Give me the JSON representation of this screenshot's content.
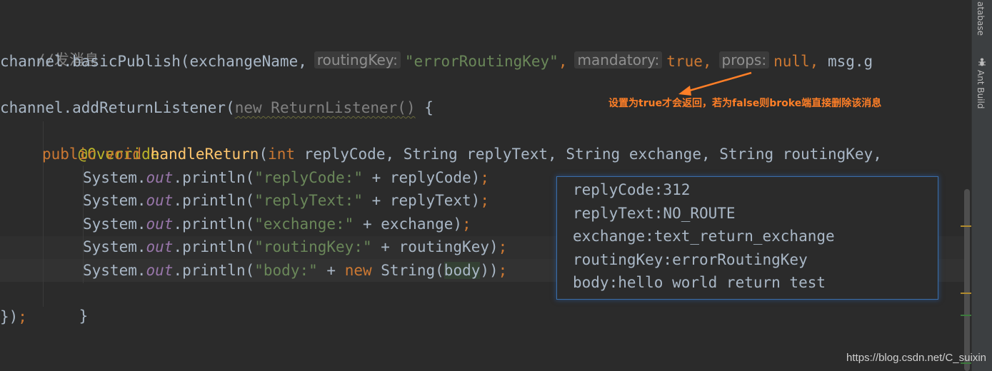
{
  "comment": "//发消息",
  "publish_line": {
    "prefix": "channel.basicPublish(exchangeName,",
    "hint_routing_key": "routingKey:",
    "routing_key_value": "\"errorRoutingKey\"",
    "comma1": ",",
    "hint_mandatory": "mandatory:",
    "mandatory_value": "true",
    "comma2": ",",
    "hint_props": "props:",
    "props_value": "null",
    "comma3": ",",
    "suffix": " msg.g"
  },
  "listener_line": {
    "prefix": "channel.addReturnListener(",
    "anon_class": "new ReturnListener()",
    "suffix": " {"
  },
  "override_annotation": "@Override",
  "method_signature": {
    "modifiers": "public void ",
    "name": "handleReturn",
    "open": "(",
    "type_int": "int",
    "params": " replyCode, String replyText, String exchange, String routingKey,"
  },
  "println_lines": [
    {
      "receiver": "System.",
      "field": "out",
      "call": ".println(",
      "literal": "\"replyCode:\"",
      "rest": " + replyCode)",
      "semi": ";"
    },
    {
      "receiver": "System.",
      "field": "out",
      "call": ".println(",
      "literal": "\"replyText:\"",
      "rest": " + replyText)",
      "semi": ";"
    },
    {
      "receiver": "System.",
      "field": "out",
      "call": ".println(",
      "literal": "\"exchange:\"",
      "rest": " + exchange)",
      "semi": ";"
    },
    {
      "receiver": "System.",
      "field": "out",
      "call": ".println(",
      "literal": "\"routingKey:\"",
      "rest": " + routingKey)",
      "semi": ";"
    }
  ],
  "body_line": {
    "receiver": "System.",
    "field": "out",
    "call": ".println(",
    "literal": "\"body:\"",
    "plus": " + ",
    "kw_new": "new",
    "string_open": " String(",
    "arg": "body",
    "close": "))",
    "semi": ";"
  },
  "close_brace_inner": "}",
  "close_brace_outer": "})",
  "close_semi": ";",
  "annotation_text": "设置为true才会返回，若为false则broke端直接删除该消息",
  "output_lines": [
    "replyCode:312",
    "replyText:NO_ROUTE",
    "exchange:text_return_exchange",
    "routingKey:errorRoutingKey",
    "body:hello world return test"
  ],
  "sidebar": {
    "database_label": "atabase",
    "ant_build_label": "Ant Build"
  },
  "watermark": "https://blog.csdn.net/C_suixin",
  "colors": {
    "background": "#2b2b2b",
    "comment": "#808080",
    "string": "#6a8759",
    "keyword": "#cc7832",
    "annotation": "#bbb529",
    "method": "#ffc66d",
    "static_field": "#9876aa",
    "plain": "#a9b7c6",
    "arrow": "#ff7f27",
    "panel_border": "#3b6ea8"
  }
}
